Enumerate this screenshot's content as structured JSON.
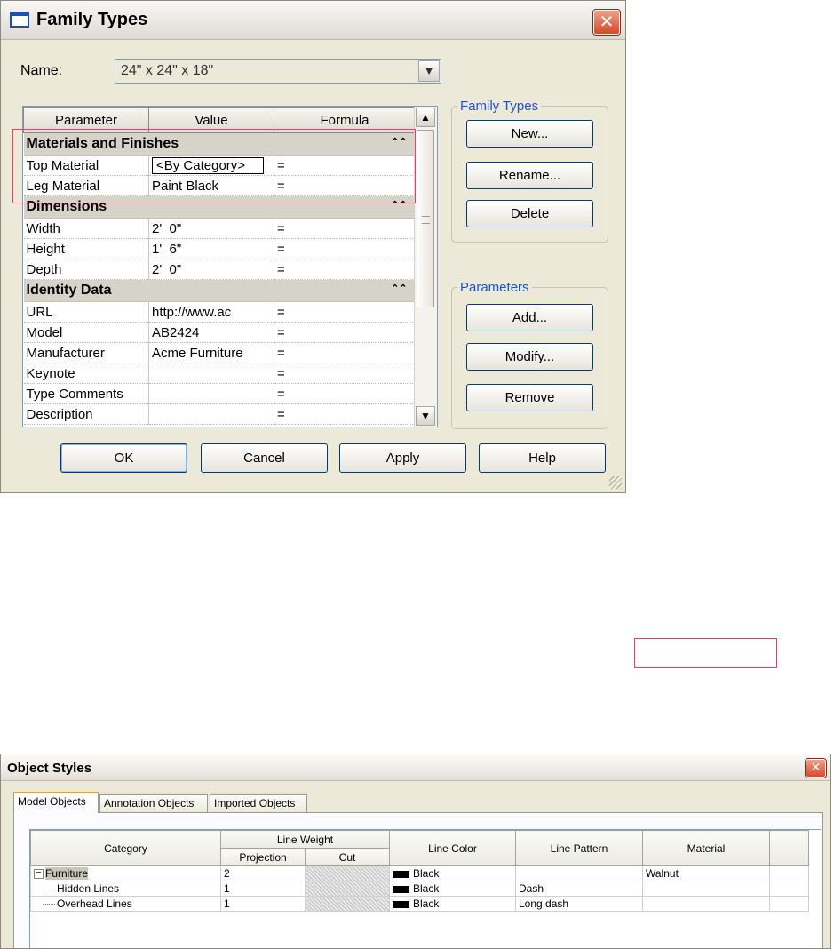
{
  "family_types": {
    "title": "Family Types",
    "close_icon": "close-icon",
    "name_label": "Name:",
    "name_value": "24\" x 24\" x 18\"",
    "columns": [
      "Parameter",
      "Value",
      "Formula"
    ],
    "groups": [
      {
        "label": "Materials and Finishes",
        "rows": [
          {
            "param": "Top Material",
            "value": "<By Category>",
            "formula": "="
          },
          {
            "param": "Leg Material",
            "value": "Paint Black",
            "formula": "="
          }
        ]
      },
      {
        "label": "Dimensions",
        "rows": [
          {
            "param": "Width",
            "value": "2'  0\"",
            "formula": "="
          },
          {
            "param": "Height",
            "value": "1'  6\"",
            "formula": "="
          },
          {
            "param": "Depth",
            "value": "2'  0\"",
            "formula": "="
          }
        ]
      },
      {
        "label": "Identity Data",
        "rows": [
          {
            "param": "URL",
            "value": "http://www.ac",
            "formula": "="
          },
          {
            "param": "Model",
            "value": "AB2424",
            "formula": "="
          },
          {
            "param": "Manufacturer",
            "value": "Acme Furniture",
            "formula": "="
          },
          {
            "param": "Keynote",
            "value": "",
            "formula": "="
          },
          {
            "param": "Type Comments",
            "value": "",
            "formula": "="
          },
          {
            "param": "Description",
            "value": "",
            "formula": "="
          }
        ]
      }
    ],
    "family_types_group": {
      "label": "Family Types",
      "new": "New...",
      "rename": "Rename...",
      "delete": "Delete"
    },
    "parameters_group": {
      "label": "Parameters",
      "add": "Add...",
      "modify": "Modify...",
      "remove": "Remove"
    },
    "footer": {
      "ok": "OK",
      "cancel": "Cancel",
      "apply": "Apply",
      "help": "Help"
    },
    "highlight_color": "#e0407a"
  },
  "object_styles": {
    "title": "Object Styles",
    "tabs": [
      "Model Objects",
      "Annotation Objects",
      "Imported Objects"
    ],
    "active_tab": "Model Objects",
    "columns": {
      "category": "Category",
      "line_weight": "Line Weight",
      "projection": "Projection",
      "cut": "Cut",
      "line_color": "Line Color",
      "line_pattern": "Line Pattern",
      "material": "Material"
    },
    "rows": [
      {
        "category": "Furniture",
        "expander": "⊟",
        "projection": "2",
        "color": "Black",
        "pattern": "",
        "material": "Walnut"
      },
      {
        "category": "Hidden Lines",
        "projection": "1",
        "color": "Black",
        "pattern": "Dash",
        "material": ""
      },
      {
        "category": "Overhead Lines",
        "projection": "1",
        "color": "Black",
        "pattern": "Long dash",
        "material": ""
      }
    ]
  }
}
